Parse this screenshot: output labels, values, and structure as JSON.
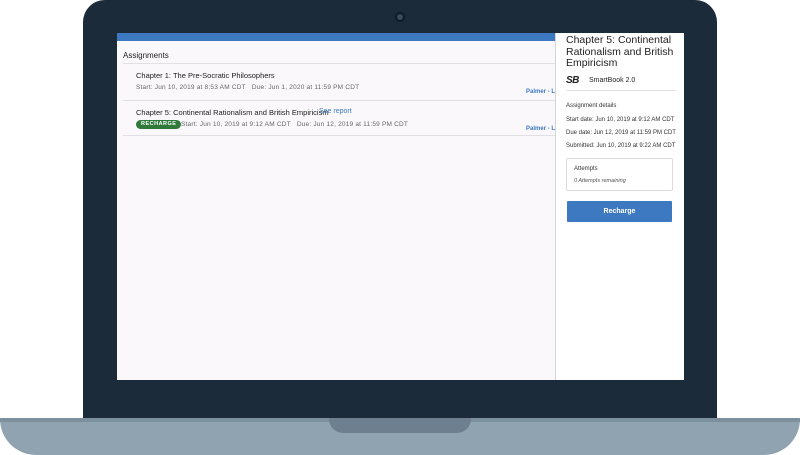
{
  "main": {
    "section_title": "Assignments",
    "assignments": [
      {
        "title": "Chapter 1: The Pre-Socratic Philosophers",
        "start": "Start: Jun 10, 2019 at 8:53 AM CDT",
        "due": "Due: Jun 1, 2020 at 11:59 PM CDT",
        "instructor": "Palmer - L"
      },
      {
        "title": "Chapter 5: Continental Rationalism and British Empiricism",
        "link": "See report",
        "badge": "RECHARGE",
        "start": "Start: Jun 10, 2019 at 9:12 AM CDT",
        "due": "Due: Jun 12, 2019 at 11:59 PM CDT",
        "instructor": "Palmer - L"
      }
    ]
  },
  "side": {
    "title": "Chapter 5: Continental Rationalism and British Empiricism",
    "logo": "SB",
    "product": "SmartBook 2.0",
    "details_title": "Assignment details",
    "start_date": "Start date: Jun 10, 2019 at 9:12 AM CDT",
    "due_date": "Due date: Jun 12, 2019 at 11:59 PM CDT",
    "submitted": "Submitted: Jun 10, 2019 at 9:22 AM CDT",
    "attempts_title": "Attempts",
    "attempts_value": "0 Attempts remaining",
    "button": "Recharge"
  },
  "colors": {
    "accent": "#3d79c1",
    "badge": "#2f7a3b",
    "laptop_lid": "#1b2b3a",
    "laptop_base": "#8fa3b1"
  },
  "icons": {
    "logo": "smartbook-logo-icon",
    "camera": "webcam-icon"
  }
}
